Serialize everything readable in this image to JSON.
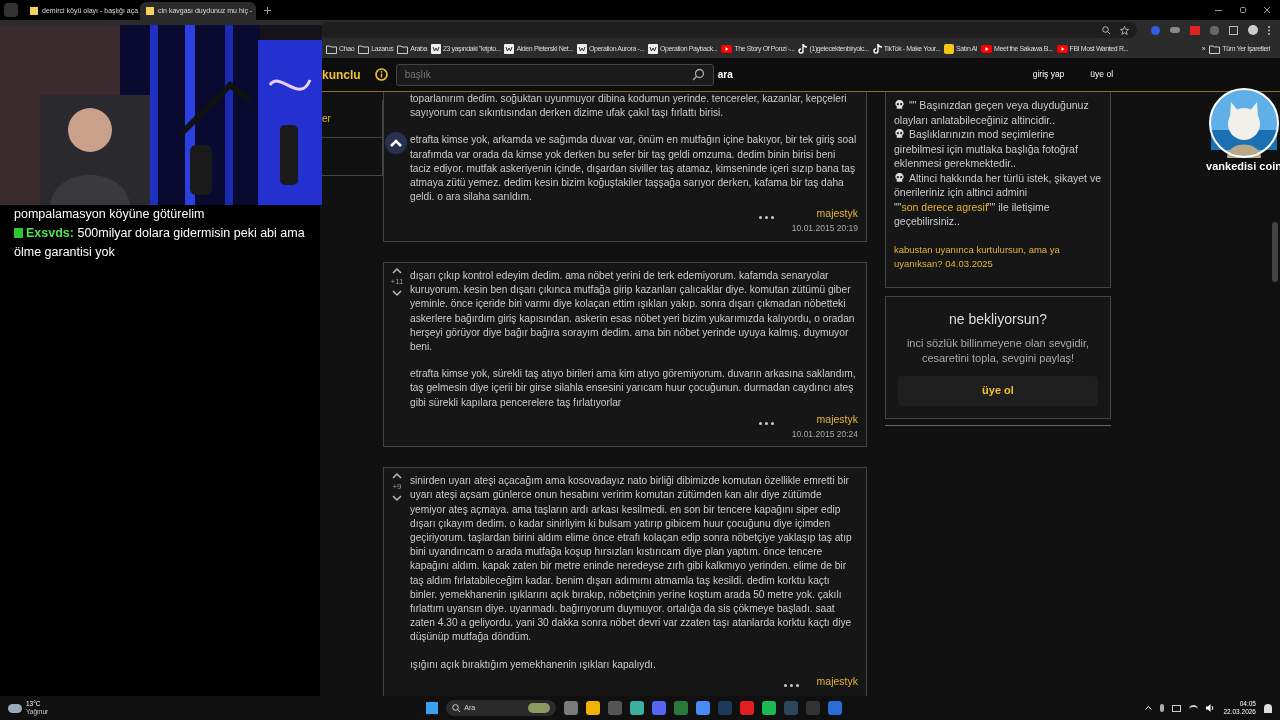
{
  "browser": {
    "tabs": [
      {
        "title": "demirci köyü olayı - başlığı aça",
        "selected": false
      },
      {
        "title": "cin kavgası duydunuz mu hiç -",
        "selected": true
      }
    ],
    "bookmarks": [
      {
        "label": "Chao",
        "kind": "folder"
      },
      {
        "label": "Lazarus",
        "kind": "folder"
      },
      {
        "label": "Araba",
        "kind": "folder"
      },
      {
        "label": "23 yaşındaki \"kripto...",
        "kind": "page"
      },
      {
        "label": "Aiden Pleterski Net...",
        "kind": "page"
      },
      {
        "label": "Operation Aurora -...",
        "kind": "page"
      },
      {
        "label": "Operation Payback...",
        "kind": "page"
      },
      {
        "label": "The Story Of Ponzi -...",
        "kind": "video"
      },
      {
        "label": "(1)gelecektenbiryolc...",
        "kind": "tiktok"
      },
      {
        "label": "TikTok - Make Your...",
        "kind": "tiktok"
      },
      {
        "label": "Satın Al",
        "kind": "app"
      },
      {
        "label": "Meet the Sakawa B...",
        "kind": "video"
      },
      {
        "label": "FBI Most Wanted R...",
        "kind": "video"
      },
      {
        "label": "»",
        "kind": "more"
      },
      {
        "label": "Tüm Yer İşaretleri",
        "kind": "folder"
      }
    ]
  },
  "site": {
    "logo": "kunclu",
    "search": {
      "placeholder": "başlık"
    },
    "search_button": "ara",
    "login": "giriş yap",
    "signup": "üye ol",
    "sidebar": [
      {
        "label": "er"
      }
    ],
    "entries": [
      {
        "paragraphs": [
          "toparlanırım dedim. soğuktan uyunmuyor dibina kodumun yerinde. tencereler, kazanlar, kepçeleri sayıyorum can sıkıntısından derken dizime ufak çakıl taşı fırlattı birisi.",
          "etrafta kimse yok, arkamda ve sağımda duvar var, önüm en mutfağın içine bakıyor, bir tek giriş soal tarafımda var orada da kimse yok derken bu sefer bir taş geldi omzuma. dedim binin birisi beni taciz ediyor. mutfak askeriyenin içinde, dışardan siviller taş atamaz, kimseninde içeri sızıp bana taş atmaya zütü yemez. dedim kesin bizim koğuştakiler taşşağa sarıyor derken, kafama bir taş daha geldi. o ara silaha sarıldım."
        ],
        "author": "majestyk",
        "date": "10.01.2015 20:19"
      },
      {
        "votes": "+11",
        "paragraphs": [
          "dışarı çıkıp kontrol edeyim dedim. ama nöbet yerini de terk edemiyorum. kafamda senaryolar kuruyorum. kesin ben dışarı çıkınca mutfağa girip kazanları çalıcaklar diye. komutan zütümü giber yeminle. önce içeride biri varmı diye kolaçan ettim ışıkları yakıp. sonra dışarı çıkmadan nöbetteki askerlere bağırdım giriş kapısından. askerin esas nöbet yeri bizim yukarımızda kalıyordu, o oradan herşeyi görüyor diye bağır bağıra sorayım dedim. ama bin nöbet yerinde uyuya kalmış. duymuyor beni.",
          "etrafta kimse yok, sürekli taş atıyo birileri ama kim atıyo göremiyorum. duvarın arkasına saklandım, taş gelmesin diye içerii bir girse silahla ensesini yarıcam huur çocuğunun. durmadan caydırıcı ateş gibi sürekli kapılara pencerelere taş fırlatıyorlar"
        ],
        "author": "majestyk",
        "date": "10.01.2015 20:24"
      },
      {
        "votes": "+9",
        "paragraphs": [
          "sinirden uyarı ateşi açacağım ama kosovadayız nato birliği dibimizde komutan özellikle emretti bir uyarı ateşi açsam günlerce onun hesabını veririm komutan zütümden kan alır diye zütümde yemiyor ateş açmaya. ama taşların ardı arkası kesilmedi. en son bir tencere kapağını siper edip dışarı çıkayım dedim. o kadar sinirliyim ki bulsam yatırıp gibicem huur çocuğunu diye içimden geçiriyorum. taşlardan birini aldım elime önce etrafı kolaçan edip sonra nöbetçiye yaklaşıp taş atıp bini uyandırıcam o arada mutfağa koşup hırsızları kıstırıcam diye plan yaptım. önce tencere kapağını aldım. kapak zaten bir metre eninde neredeyse zırh gibi kalkmıyo yerinden. elime de bir taş aldım fırlatabileceğim kadar. benim dışarı adımımı atmamla taş kesildi. dedim korktu kaçtı binler. yemekhanenin ışıklarını açık bırakıp, nöbetçinin yerine koştum arada 50 metre yok. çakılı fırlattım uyansın diye. uyanmadı. bağırıyorum duymuyor. ortalığa da sis çökmeye başladı. saat zaten 4.30 a geliyordu. yani 30 dakka sonra nöbet devri var zzaten taşı atanlarda korktu kaçtı diye düşünüp mutfağa döndüm.",
          "ışığını açık bıraktığım yemekhanenin ışıkları kapalıydı."
        ],
        "author": "majestyk"
      }
    ],
    "rules": [
      {
        "parts": [
          {
            "text": "\"\" Başınızdan geçen veya duyduğunuz olayları anlatabileceğiniz altincidir.."
          }
        ]
      },
      {
        "parts": [
          {
            "text": "Başlıklarınızın mod seçimlerine girebilmesi için mutlaka başlığa fotoğraf eklenmesi gerekmektedir.."
          }
        ]
      },
      {
        "parts": [
          {
            "text": "Altinci hakkında her türlü istek, şikayet ve önerileriniz için altinci admini \"\""
          },
          {
            "text": "son derece agresif",
            "link": true
          },
          {
            "text": "\"\" ile iletişime geçebilirsiniz.."
          }
        ]
      }
    ],
    "motto": "kabustan uyanınca kurtulursun, ama ya uyanıksan? 04.03.2025",
    "join_card": {
      "title": "ne bekliyorsun?",
      "text": "inci sözlük billinmeyene olan sevgidir, cesaretini topla, sevgini paylaş!",
      "button": "üye ol"
    }
  },
  "chat": [
    {
      "text": "pompalamasyon köyüne götürelim"
    },
    {
      "user": "Exsvds:",
      "text": "500milyar dolara gidermisin peki abi ama ölme garantisi yok"
    }
  ],
  "avatar": {
    "caption": "vankedisi coin"
  },
  "taskbar": {
    "weather": {
      "temp": "13°C",
      "condition": "Yağmur"
    },
    "search": "Ara",
    "time": "04:05",
    "date": "22.03.2026"
  }
}
